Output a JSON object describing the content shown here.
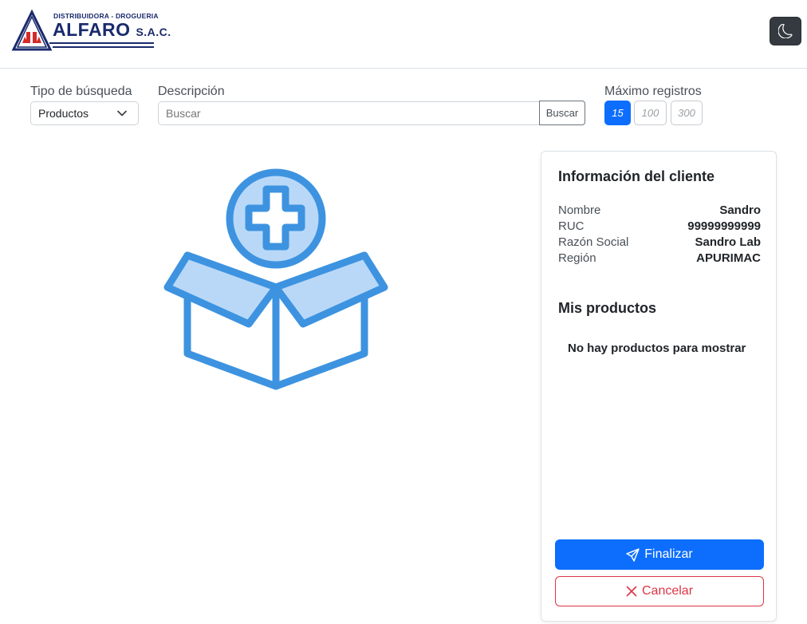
{
  "header": {
    "logo": {
      "subtitle": "DISTRIBUIDORA - DROGUERIA",
      "name": "ALFARO",
      "suffix": "S.A.C."
    },
    "theme_toggle_icon": "moon-icon"
  },
  "filters": {
    "search_type": {
      "label": "Tipo de búsqueda",
      "selected": "Productos"
    },
    "description": {
      "label": "Descripción",
      "placeholder": "Buscar",
      "button": "Buscar"
    },
    "max_records": {
      "label": "Máximo registros",
      "options": [
        "15",
        "100",
        "300"
      ],
      "selected": "15"
    }
  },
  "illustration_icon": "box-add-icon",
  "client_panel": {
    "title": "Información del cliente",
    "fields": [
      {
        "key": "Nombre",
        "value": "Sandro"
      },
      {
        "key": "RUC",
        "value": "99999999999"
      },
      {
        "key": "Razón Social",
        "value": "Sandro Lab"
      },
      {
        "key": "Región",
        "value": "APURIMAC"
      }
    ],
    "products_title": "Mis productos",
    "empty_message": "No hay productos para mostrar",
    "finalize_button": "Finalizar",
    "cancel_button": "Cancelar"
  },
  "colors": {
    "primary": "#0d6efd",
    "danger": "#dc3545",
    "illustration_stroke": "#3d93e0",
    "illustration_fill": "#b9d8f8",
    "logo_navy": "#1a2a6c",
    "logo_red": "#d42a2a"
  }
}
